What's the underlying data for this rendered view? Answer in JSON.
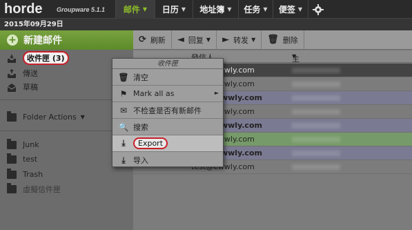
{
  "app": {
    "logo": "horde",
    "version": "Groupware 5.1.1"
  },
  "nav": [
    {
      "label": "邮件",
      "active": true
    },
    {
      "label": "日历"
    },
    {
      "label": "地址簿"
    },
    {
      "label": "任务"
    },
    {
      "label": "便签"
    }
  ],
  "date": "2015年09月29日",
  "sidebar": {
    "compose": "新建邮件",
    "inbox": "收件匣 (3)",
    "sent": "傳送",
    "drafts": "草稿",
    "folder_actions": "Folder Actions",
    "junk": "Junk",
    "test": "test",
    "trash": "Trash",
    "virtual": "虛擬信件匣"
  },
  "toolbar": {
    "refresh": "刷新",
    "reply": "回复",
    "forward": "转发",
    "delete": "删除"
  },
  "columns": {
    "from": "發信人",
    "subject": "主題"
  },
  "messages": [
    {
      "from": "test@ewwly.com"
    },
    {
      "from": "test@ewwly.com"
    },
    {
      "from": "test@ewwly.com"
    },
    {
      "from": "test@ewwly.com"
    },
    {
      "from": "test@ewwly.com"
    },
    {
      "from": "test@ewwly.com"
    },
    {
      "from": "test@ewwly.com"
    },
    {
      "from": "test@ewwly.com"
    }
  ],
  "context_menu": {
    "title": "收件匣",
    "empty": "清空",
    "mark_all": "Mark all as",
    "no_check": "不检查是否有新邮件",
    "search": "搜索",
    "export": "Export",
    "import": "导入"
  },
  "colors": {
    "accent": "#8fbd2a",
    "highlight": "#c8202a"
  }
}
